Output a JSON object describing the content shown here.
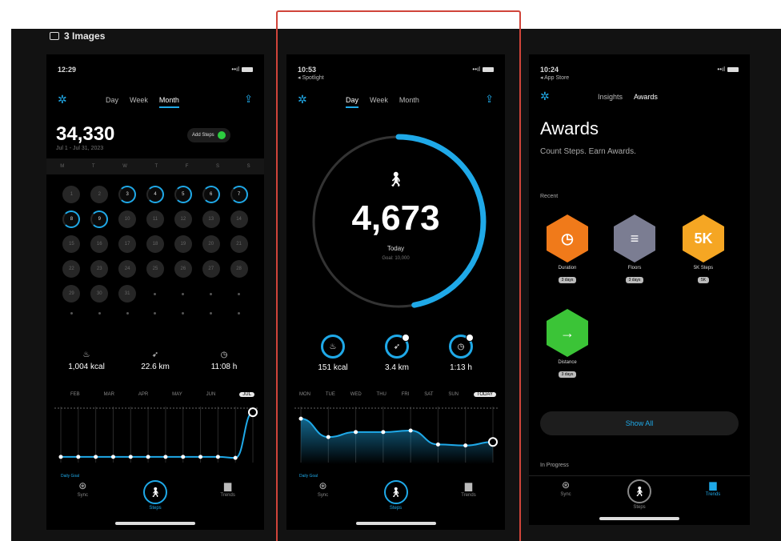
{
  "header": {
    "label": "3 Images"
  },
  "screen1": {
    "status_time": "12:29",
    "status_signal": "••ıl",
    "tabs": [
      "Day",
      "Week",
      "Month"
    ],
    "active_tab": "Month",
    "total": "34,330",
    "total_sub": "Jul 1 - Jul 31, 2023",
    "goal_pill": "Add Steps",
    "weekdays": [
      "M",
      "T",
      "W",
      "T",
      "F",
      "S",
      "S"
    ],
    "days": [
      {
        "n": "1",
        "ring": false
      },
      {
        "n": "2",
        "ring": false
      },
      {
        "n": "3",
        "ring": true
      },
      {
        "n": "4",
        "ring": true
      },
      {
        "n": "5",
        "ring": true
      },
      {
        "n": "6",
        "ring": true
      },
      {
        "n": "7",
        "ring": true
      },
      {
        "n": "8",
        "ring": true
      },
      {
        "n": "9",
        "ring": true
      },
      {
        "n": "10",
        "ring": false
      },
      {
        "n": "11",
        "ring": false
      },
      {
        "n": "12",
        "ring": false
      },
      {
        "n": "13",
        "ring": false
      },
      {
        "n": "14",
        "ring": false
      },
      {
        "n": "15",
        "ring": false
      },
      {
        "n": "16",
        "ring": false
      },
      {
        "n": "17",
        "ring": false
      },
      {
        "n": "18",
        "ring": false
      },
      {
        "n": "19",
        "ring": false
      },
      {
        "n": "20",
        "ring": false
      },
      {
        "n": "21",
        "ring": false
      },
      {
        "n": "22",
        "ring": false
      },
      {
        "n": "23",
        "ring": false
      },
      {
        "n": "24",
        "ring": false
      },
      {
        "n": "25",
        "ring": false
      },
      {
        "n": "26",
        "ring": false
      },
      {
        "n": "27",
        "ring": false
      },
      {
        "n": "28",
        "ring": false
      },
      {
        "n": "29",
        "ring": false
      },
      {
        "n": "30",
        "ring": false
      },
      {
        "n": "31",
        "ring": false
      }
    ],
    "stats": [
      {
        "icon": "flame-icon",
        "glyph": "♨",
        "value": "1,004 kcal"
      },
      {
        "icon": "distance-icon",
        "glyph": "➶",
        "value": "22.6 km"
      },
      {
        "icon": "clock-icon",
        "glyph": "◷",
        "value": "11:08 h"
      }
    ],
    "months": [
      "FEB",
      "MAR",
      "APR",
      "MAY",
      "JUN",
      "JUL"
    ],
    "active_month": "JUL",
    "chart_values": [
      0.05,
      0.05,
      0.05,
      0.05,
      0.05,
      0.05,
      0.05,
      0.05,
      0.05,
      0.05,
      0.03,
      0.95
    ],
    "legend": "Daily Goal",
    "nav": [
      "Sync",
      "Steps",
      "Trends"
    ]
  },
  "screen2": {
    "status_time": "10:53",
    "status_sub": "◂ Spotlight",
    "tabs": [
      "Day",
      "Week",
      "Month"
    ],
    "active_tab": "Day",
    "steps": "4,673",
    "steps_label": "Today",
    "steps_goal": "Goal: 10,000",
    "ring_progress": 0.47,
    "stats": [
      {
        "icon": "flame-icon",
        "glyph": "♨",
        "value": "151 kcal"
      },
      {
        "icon": "distance-icon",
        "glyph": "➶",
        "value": "3.4 km"
      },
      {
        "icon": "clock-icon",
        "glyph": "◷",
        "value": "1:13 h"
      }
    ],
    "days": [
      "MON",
      "TUE",
      "WED",
      "THU",
      "FRI",
      "SAT",
      "SUN"
    ],
    "active_day": "TODAY",
    "chart_values": [
      0.82,
      0.45,
      0.55,
      0.55,
      0.58,
      0.3,
      0.28,
      0.35
    ],
    "legend": "Daily Goal",
    "nav": [
      "Sync",
      "Steps",
      "Trends"
    ]
  },
  "screen3": {
    "status_time": "10:24",
    "status_sub": "◂ App Store",
    "tabs": [
      "Insights",
      "Awards"
    ],
    "active_tab": "Awards",
    "title": "Awards",
    "subtitle": "Count Steps. Earn Awards.",
    "recent_label": "Recent",
    "awards": [
      {
        "name": "Duration",
        "tag": "3 days",
        "color": "#f07a1a",
        "glyph": "◷",
        "icon": "duration-award-icon"
      },
      {
        "name": "Floors",
        "tag": "3 days",
        "color": "#7b7d92",
        "glyph": "≡",
        "icon": "floors-award-icon"
      },
      {
        "name": "5K Steps",
        "tag": "5K",
        "color": "#f5a623",
        "glyph": "5K",
        "icon": "5k-award-icon"
      },
      {
        "name": "Distance",
        "tag": "3 days",
        "color": "#3bc437",
        "glyph": "→",
        "icon": "distance-award-icon"
      }
    ],
    "show_all": "Show All",
    "in_progress": "In Progress",
    "nav": [
      "Sync",
      "Steps",
      "Trends"
    ]
  },
  "colors": {
    "accent": "#1fa9e8",
    "highlight": "#d0443a"
  }
}
